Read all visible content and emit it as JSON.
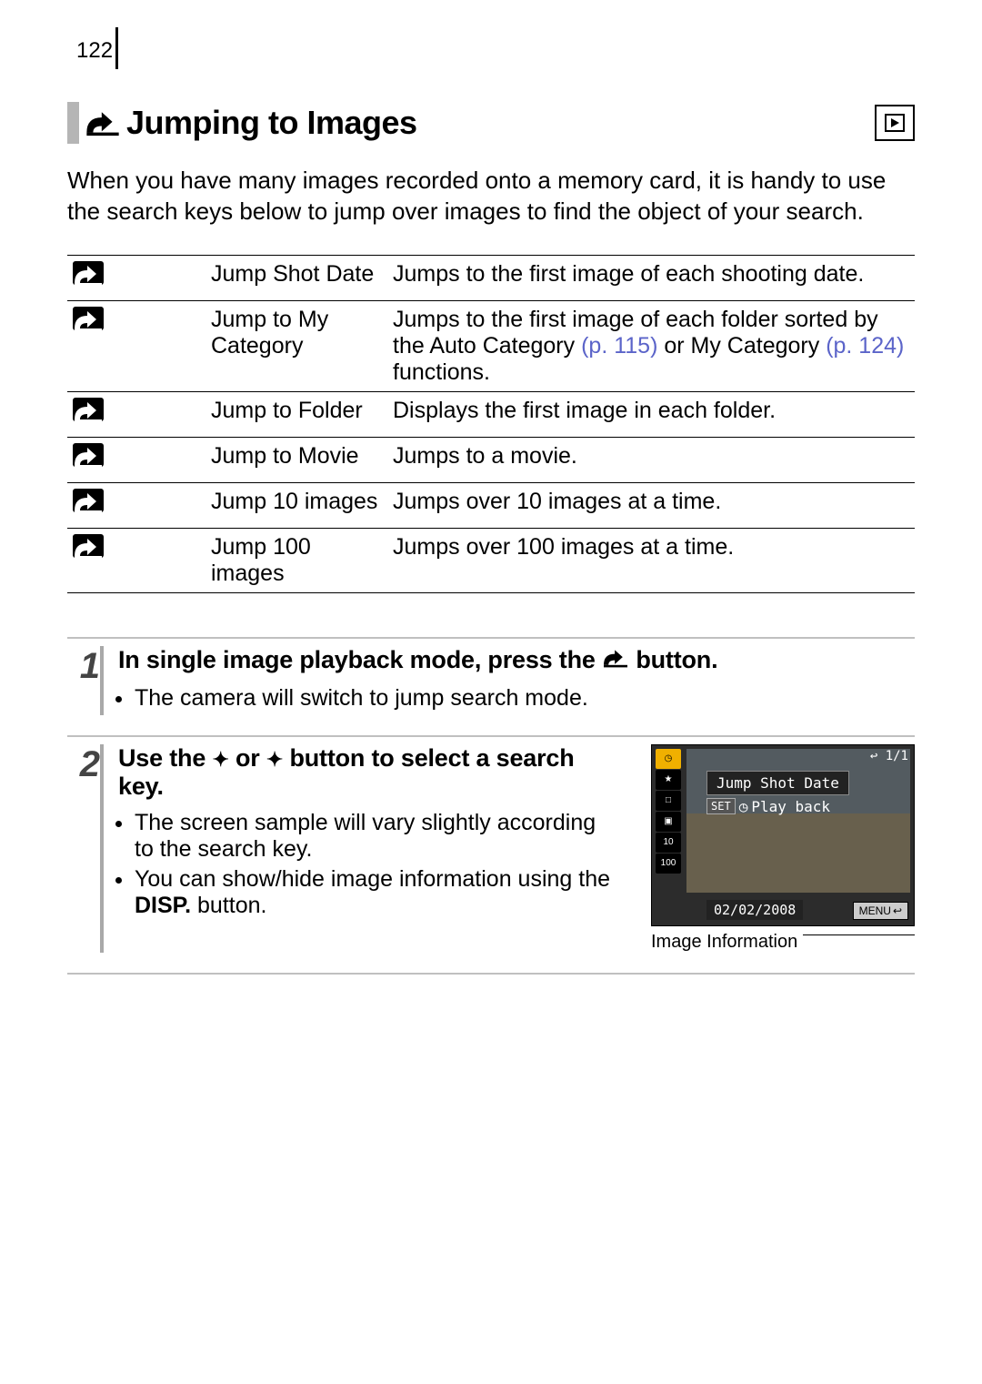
{
  "page_number": "122",
  "section": {
    "title": "Jumping to Images",
    "play_mode_icon": "playback-mode-icon",
    "intro": "When you have many images recorded onto a memory card, it is handy to use the search keys below to jump over images to find the object of your search."
  },
  "search_keys": [
    {
      "icon": "jump-shot-date-icon",
      "label": "Jump Shot Date",
      "desc": "Jumps to the first image of each shooting date.",
      "ref1": "",
      "ref2": ""
    },
    {
      "icon": "jump-my-category-icon",
      "label": "Jump to My Category",
      "desc_prefix": "Jumps to the first image of each folder sorted by the Auto Category ",
      "ref1": "(p. 115)",
      "desc_mid": " or My Category ",
      "ref2": "(p. 124)",
      "desc_suffix": " functions."
    },
    {
      "icon": "jump-folder-icon",
      "label": "Jump to Folder",
      "desc": "Displays the first image in each folder.",
      "ref1": "",
      "ref2": ""
    },
    {
      "icon": "jump-movie-icon",
      "label": "Jump to Movie",
      "desc": "Jumps to a movie.",
      "ref1": "",
      "ref2": ""
    },
    {
      "icon": "jump-10-icon",
      "label": "Jump 10 images",
      "desc": "Jumps over 10 images at a time.",
      "ref1": "",
      "ref2": ""
    },
    {
      "icon": "jump-100-icon",
      "label": "Jump 100 images",
      "desc": "Jumps over 100 images at a time.",
      "ref1": "",
      "ref2": ""
    }
  ],
  "steps": {
    "s1": {
      "num": "1",
      "title_prefix": "In single image playback mode, press the ",
      "title_suffix": " button.",
      "bullet1": "The camera will switch to jump search mode."
    },
    "s2": {
      "num": "2",
      "title_prefix": "Use the ",
      "title_mid": " or ",
      "title_suffix": " button to select a search key.",
      "bullet1": "The screen sample will vary slightly according to the search key.",
      "bullet2_prefix": "You can show/hide image information using the ",
      "disp": "DISP.",
      "bullet2_suffix": " button."
    }
  },
  "lcd": {
    "tooltip": "Jump Shot Date",
    "set": "SET",
    "play": "Play back",
    "date": "02/02/2008",
    "menu": "MENU",
    "counter": "1/1",
    "caption": "Image Information"
  }
}
